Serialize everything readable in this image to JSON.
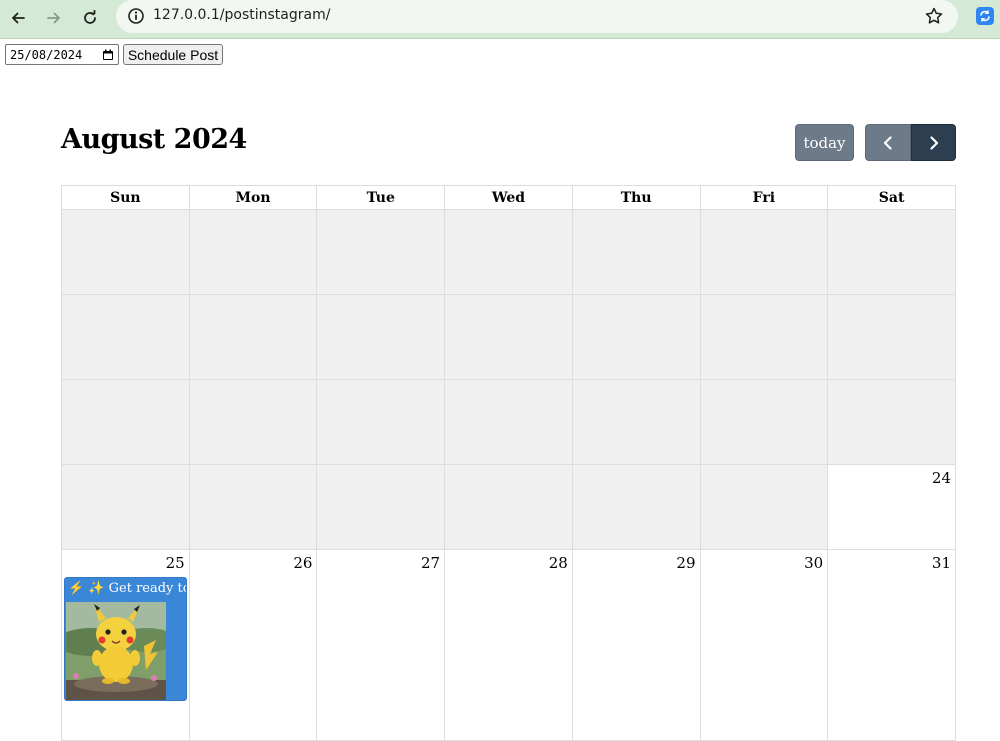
{
  "browser": {
    "url": "127.0.0.1/postinstagram/"
  },
  "form": {
    "date_value": "25/08/2024",
    "schedule_label": "Schedule Post"
  },
  "calendar": {
    "title": "August 2024",
    "today_label": "today",
    "weekdays": [
      "Sun",
      "Mon",
      "Tue",
      "Wed",
      "Thu",
      "Fri",
      "Sat"
    ],
    "week4": {
      "sat": "24"
    },
    "week5": {
      "sun": "25",
      "mon": "26",
      "tue": "27",
      "wed": "28",
      "thu": "29",
      "fri": "30",
      "sat": "31"
    },
    "event": {
      "title": "⚡ ✨ Get ready to sp",
      "color": "#3a87d8"
    }
  }
}
